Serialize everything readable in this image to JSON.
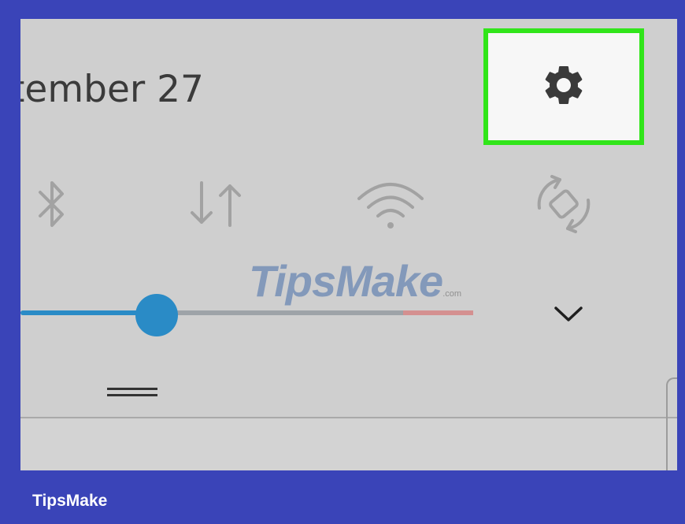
{
  "notification_shade": {
    "date_text": "tember 27",
    "settings_button": {
      "icon": "gear-icon",
      "highlight_color": "#31e51a"
    },
    "quick_settings": [
      {
        "name": "bluetooth",
        "icon": "bluetooth-icon"
      },
      {
        "name": "mobile-data",
        "icon": "data-transfer-icon"
      },
      {
        "name": "wifi",
        "icon": "wifi-icon"
      },
      {
        "name": "auto-rotate",
        "icon": "auto-rotate-icon"
      }
    ],
    "brightness_slider": {
      "level": 0.3,
      "fill_color": "#2a8bc6"
    },
    "expand_icon": "chevron-down-icon",
    "drag_handle_icon": "drag-handle-icon"
  },
  "watermark": {
    "text": "TipsMake",
    "suffix": ".com"
  },
  "brand": {
    "label": "TipsMake"
  },
  "colors": {
    "frame": "#3a44b8",
    "screen": "#cfcfcf",
    "icon_gray": "#a2a2a2",
    "text_dark": "#3b3b3b"
  }
}
